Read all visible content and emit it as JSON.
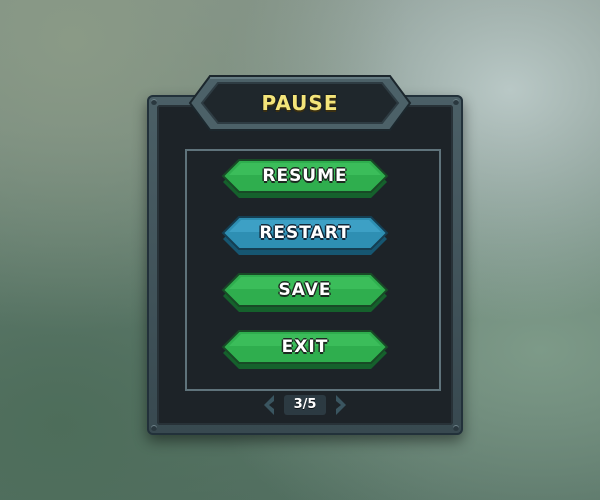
{
  "pause_menu": {
    "title": "PAUSE",
    "buttons": [
      {
        "label": "RESUME",
        "color": "#2fae4e"
      },
      {
        "label": "RESTART",
        "color": "#2e8fb3"
      },
      {
        "label": "SAVE",
        "color": "#2fae4e"
      },
      {
        "label": "EXIT",
        "color": "#2fae4e"
      }
    ],
    "pagination": {
      "current": 3,
      "total": 5,
      "label": "3/5"
    }
  },
  "colors": {
    "title_text": "#f3e47a",
    "panel_frame": "#4b5f66",
    "panel_inner": "#1d2328",
    "button_green": "#2fae4e",
    "button_blue": "#2e8fb3"
  },
  "icons": {
    "prev": "chevron-left-icon",
    "next": "chevron-right-icon"
  }
}
